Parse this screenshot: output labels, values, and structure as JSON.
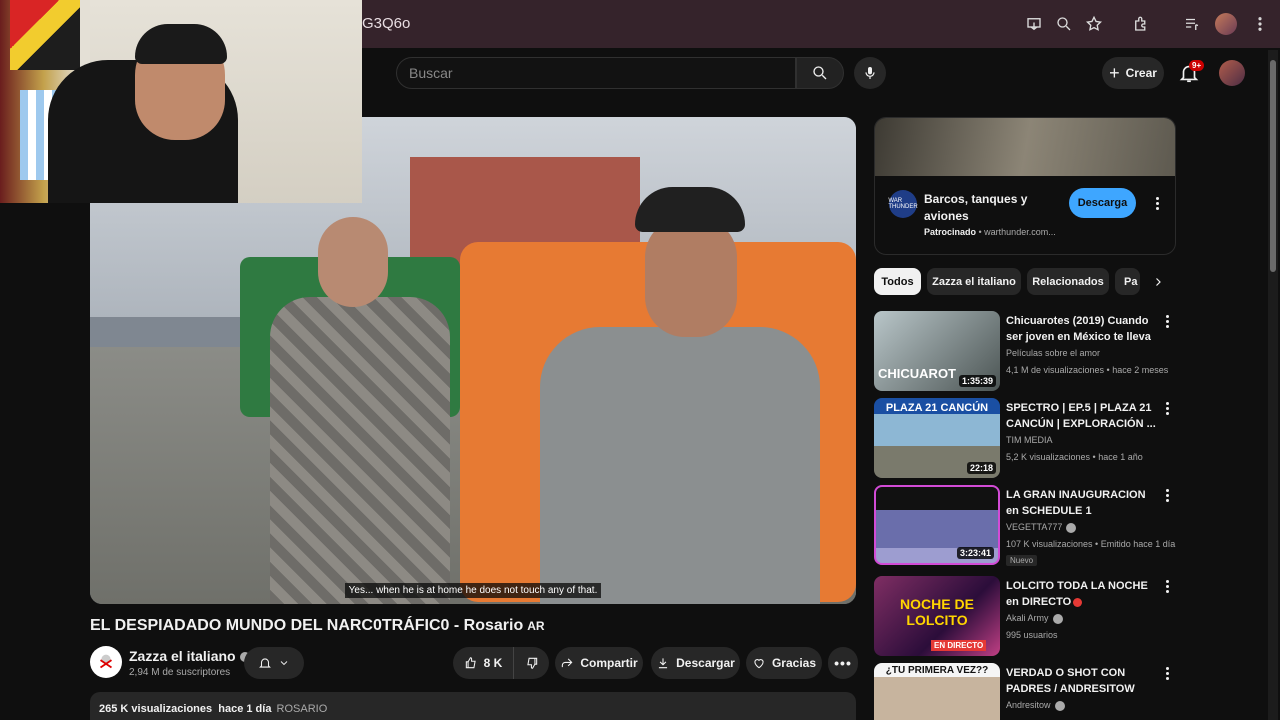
{
  "browser": {
    "url": "G3Q6o"
  },
  "header": {
    "search_placeholder": "Buscar",
    "create_label": "Crear",
    "notifications_badge": "9+"
  },
  "video": {
    "subtitle": "Yes... when he is at home he does not touch any of that.",
    "title": "EL DESPIADADO MUNDO DEL NARC0TRÁFIC0 - Rosario",
    "title_flag": "AR",
    "channel_name": "Zazza el italiano",
    "subscribers": "2,94 M de suscriptores",
    "likes": "8 K",
    "share_label": "Compartir",
    "download_label": "Descargar",
    "thanks_label": "Gracias",
    "views": "265 K visualizaciones",
    "date": "hace 1 día",
    "hashtag": "ROSARIO"
  },
  "ad": {
    "title": "Barcos, tanques y aviones",
    "sponsored": "Patrocinado",
    "domain": "warthunder.com...",
    "button": "Descarga",
    "logo_text": "WAR THUNDER"
  },
  "chips": [
    "Todos",
    "Zazza el italiano",
    "Relacionados",
    "Pa"
  ],
  "recommendations": [
    {
      "title": "Chicuarotes (2019) Cuando ser joven en México te lleva al ...",
      "channel": "Películas sobre el amor",
      "meta": "4,1 M de visualizaciones • hace 2 meses",
      "duration": "1:35:39",
      "thumb_text": "CHICUAROT"
    },
    {
      "title": "SPECTRO | EP.5 | PLAZA 21 CANCÚN | EXPLORACIÓN ...",
      "channel": "TIM MEDIA",
      "meta": "5,2 K visualizaciones • hace 1 año",
      "duration": "22:18",
      "thumb_text": "PLAZA 21 CANCÚN"
    },
    {
      "title": "LA GRAN INAUGURACION en SCHEDULE 1",
      "channel": "VEGETTA777",
      "meta": "107 K visualizaciones • Emitido hace 1 día",
      "duration": "3:23:41",
      "badge": "Nuevo"
    },
    {
      "title": "LOLCITO TODA LA NOCHE en DIRECTO",
      "channel": "Akali Army",
      "meta": "995 usuarios",
      "thumb_text": "NOCHE DE LOLCITO",
      "live_label": "EN DIRECTO"
    },
    {
      "title": "VERDAD O SHOT CON PADRES / ANDRESITOW",
      "channel": "Andresitow",
      "meta": "",
      "thumb_text": "¿TU PRIMERA VEZ??"
    }
  ],
  "colors": {
    "background": "#0f0f0f",
    "browser_bar": "#35232b",
    "accent_blue": "#3ea6ff",
    "live_red": "#e53935"
  }
}
